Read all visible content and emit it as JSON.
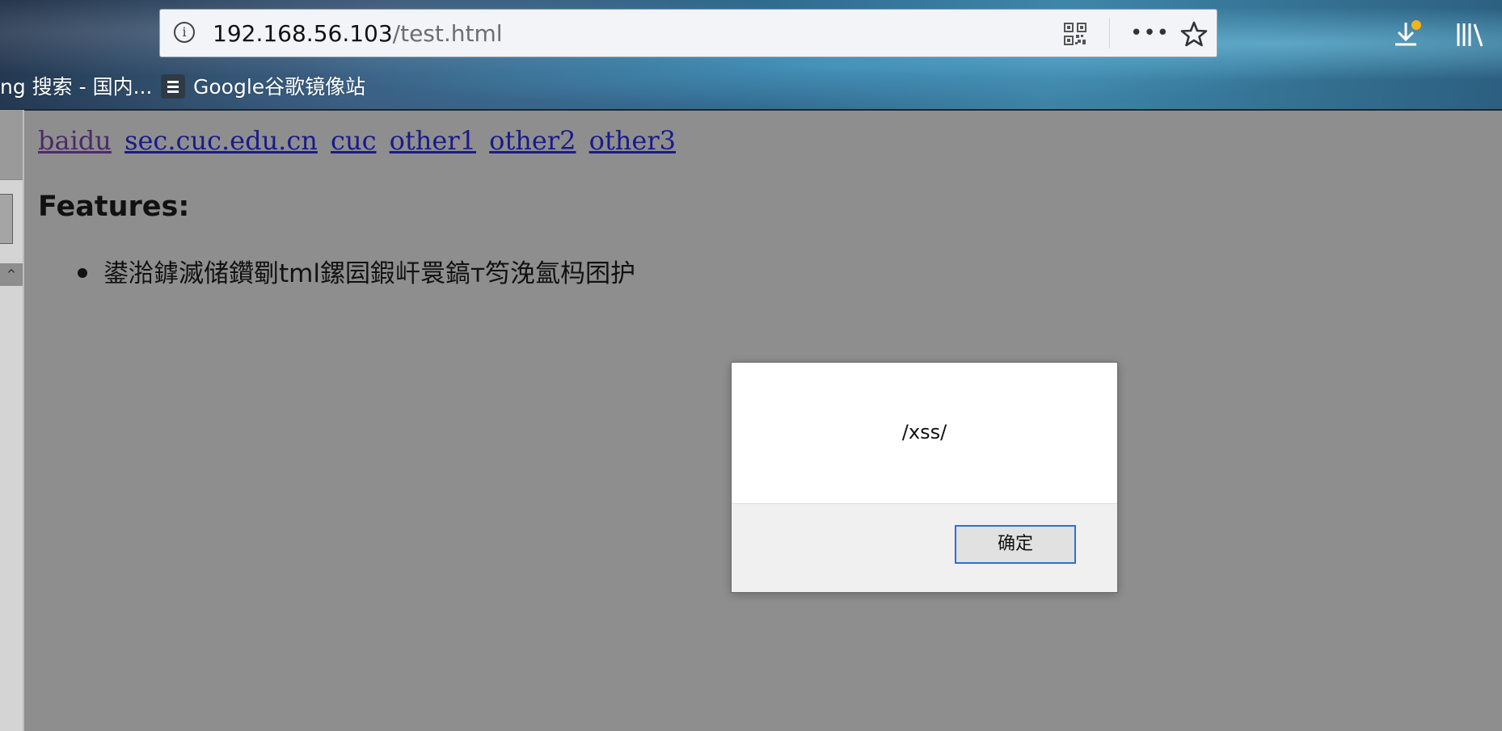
{
  "browser": {
    "address_bar": {
      "host": "192.168.56.103",
      "path": "/test.html"
    },
    "toolbar_icons": [
      "info-icon",
      "qr-code-icon",
      "more-icon",
      "star-icon",
      "download-icon",
      "library-icon"
    ],
    "bookmarks": [
      {
        "label": "ng 搜索 - 国内..."
      },
      {
        "label": "Google谷歌镜像站"
      }
    ]
  },
  "page": {
    "links": [
      {
        "label": "baidu",
        "visited": true
      },
      {
        "label": "sec.cuc.edu.cn",
        "visited": false
      },
      {
        "label": "cuc",
        "visited": false
      },
      {
        "label": "other1",
        "visited": false
      },
      {
        "label": "other2",
        "visited": false
      },
      {
        "label": "other3",
        "visited": false
      }
    ],
    "features_heading": "Features:",
    "features_items": [
      "鍙湁鎼滅储鑽劅tml鏍囩鍜屽睘鎬т笉浼氳杩囨护"
    ]
  },
  "alert": {
    "message": "/xss/",
    "ok_label": "确定"
  },
  "left_panel": {
    "scroll_arrow": "^"
  },
  "colors": {
    "link": "#1a1a8a",
    "visited_link": "#4b2a69",
    "overlay": "#8e8e8e",
    "button_focus": "#2f6fd0"
  }
}
